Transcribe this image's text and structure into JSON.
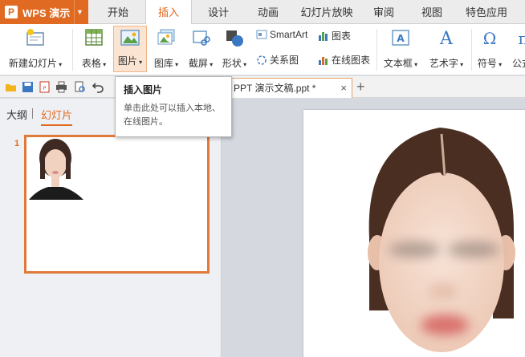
{
  "app": {
    "name": "WPS 演示",
    "logo_letter": "P",
    "accent": "#e06a22"
  },
  "menu_tabs": [
    "开始",
    "插入",
    "设计",
    "动画",
    "幻灯片放映",
    "审阅",
    "视图",
    "特色应用"
  ],
  "active_tab": "插入",
  "ribbon": {
    "new_slide": "新建幻灯片",
    "table": "表格",
    "picture": "图片",
    "gallery": "图库",
    "screenshot": "截屏",
    "shape": "形状",
    "smartart": "SmartArt",
    "chart": "图表",
    "relation": "关系图",
    "online_chart": "在线图表",
    "textbox": "文本框",
    "wordart": "艺术字",
    "symbol": "符号",
    "formula": "公式"
  },
  "document_tab": {
    "title": "PPT 演示文稿.ppt *",
    "close": "×",
    "new": "+"
  },
  "left_pane": {
    "outline_tab": "大纲",
    "slides_tab": "幻灯片",
    "slide_number": "1"
  },
  "tooltip": {
    "title": "插入图片",
    "body": "单击此处可以插入本地、在线图片。"
  },
  "icons": [
    "save-icon",
    "print-icon",
    "undo-icon",
    "picture-icon",
    "table-icon",
    "shape-icon",
    "chart-icon",
    "textbox-icon",
    "wordart-icon",
    "symbol-icon",
    "formula-icon"
  ]
}
